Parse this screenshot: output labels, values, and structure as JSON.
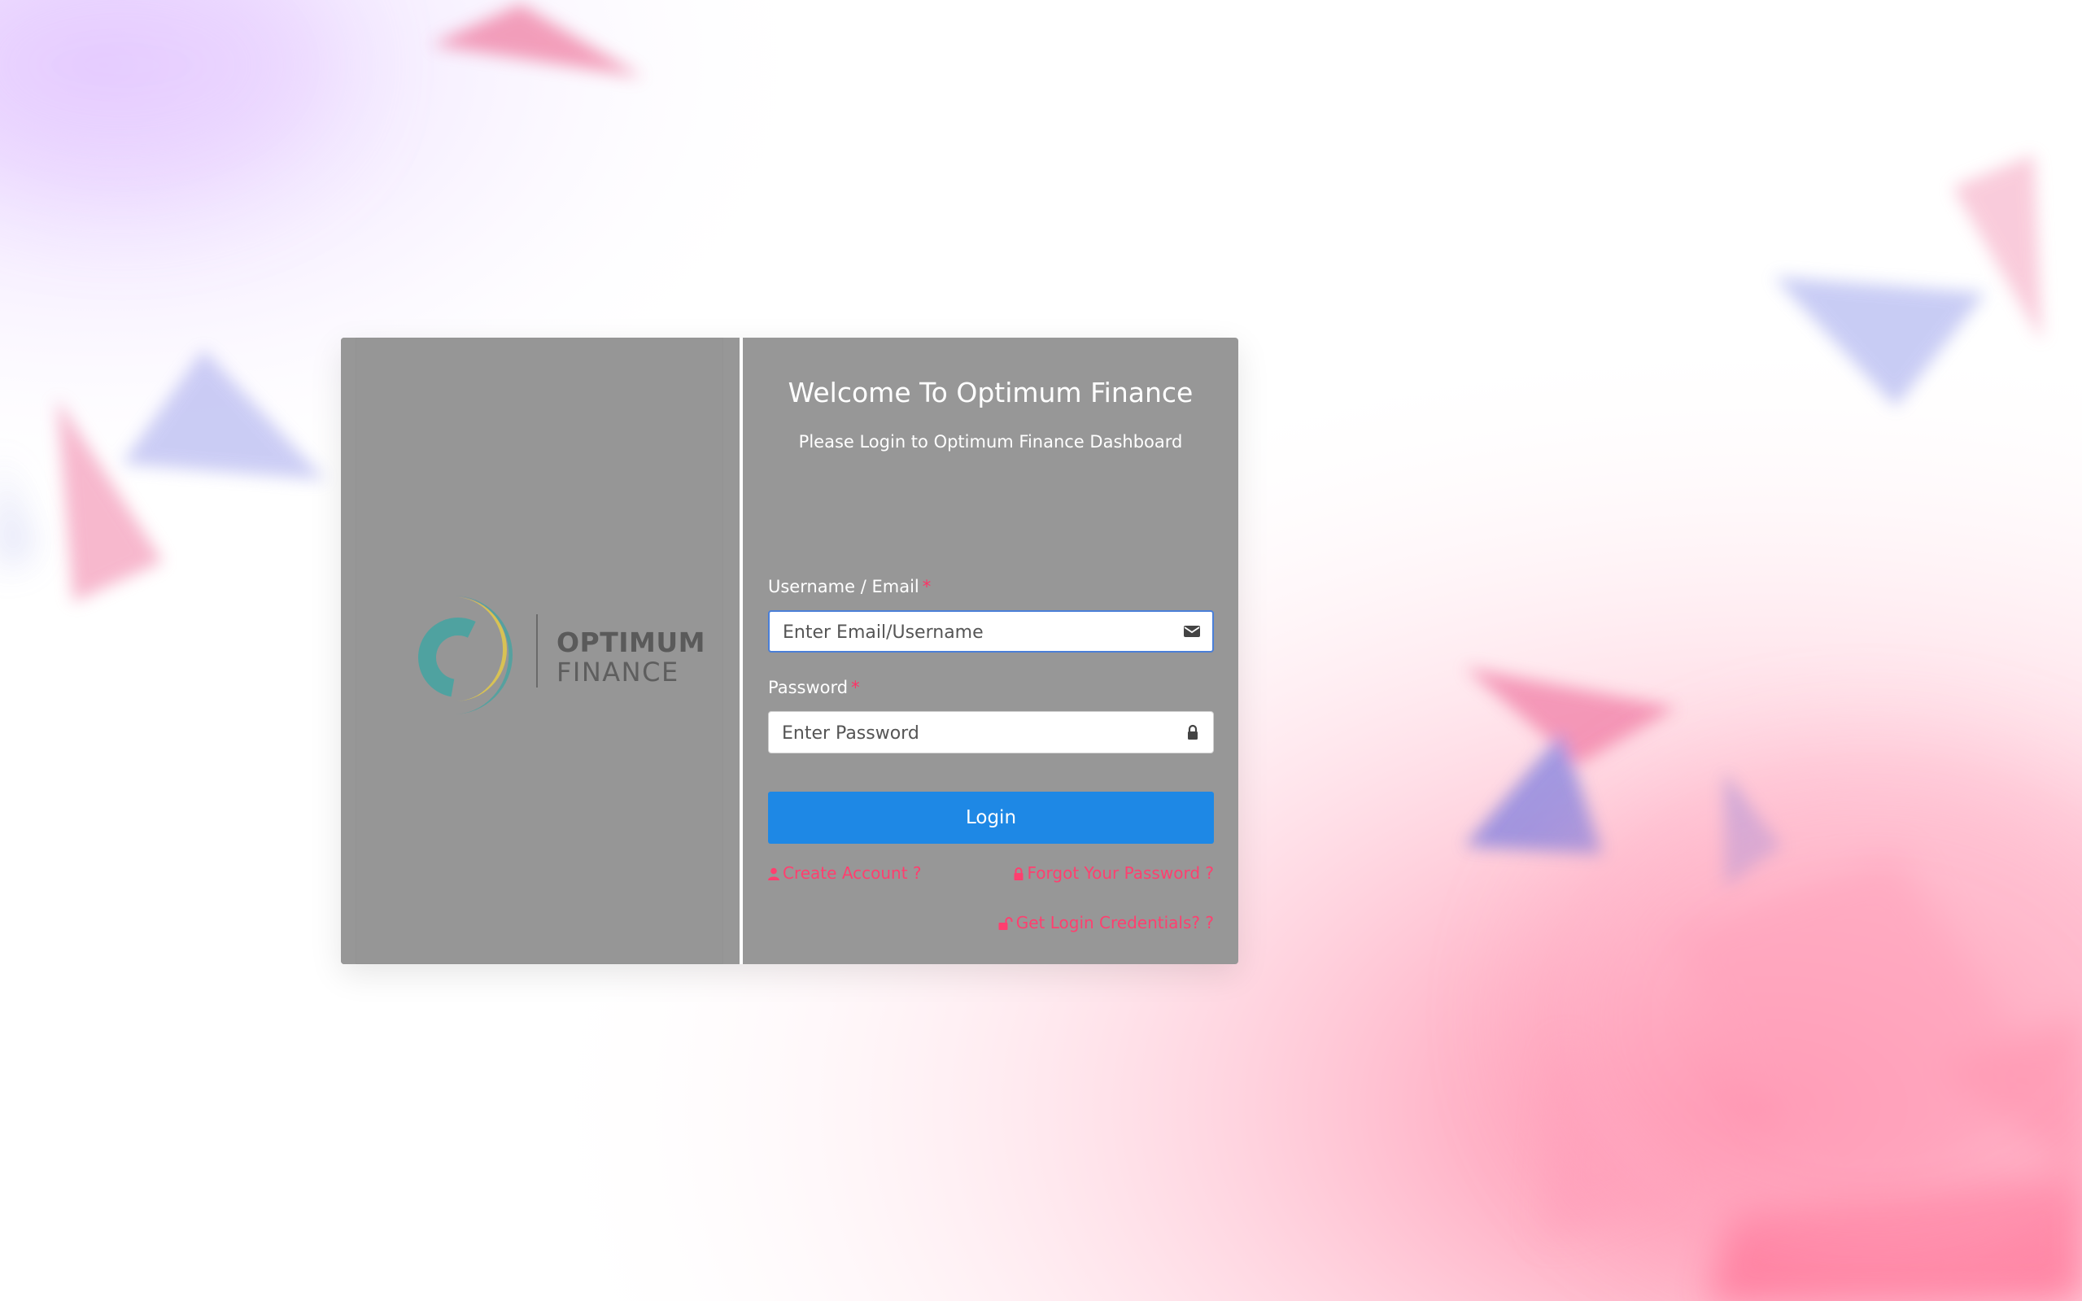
{
  "welcome": {
    "title": "Welcome To Optimum Finance",
    "subtitle": "Please Login to Optimum Finance Dashboard"
  },
  "logo": {
    "line1": "OPTIMUM",
    "line2": "FINANCE",
    "colors": {
      "ring_yellow": "#d8c254",
      "ring_teal": "#4fa2a0"
    }
  },
  "form": {
    "username_label": "Username / Email",
    "username_placeholder": "Enter Email/Username",
    "username_icon": "envelope-icon",
    "password_label": "Password",
    "password_placeholder": "Enter Password",
    "password_icon": "lock-icon",
    "required_marker": "*",
    "login_label": "Login"
  },
  "links": {
    "create_account": "Create Account ?",
    "forgot_password": "Forgot Your Password ?",
    "get_credentials": "Get Login Credentials? ?"
  },
  "colors": {
    "accent": "#1e88e5",
    "link": "#ff3f6f",
    "card": "#979797"
  }
}
